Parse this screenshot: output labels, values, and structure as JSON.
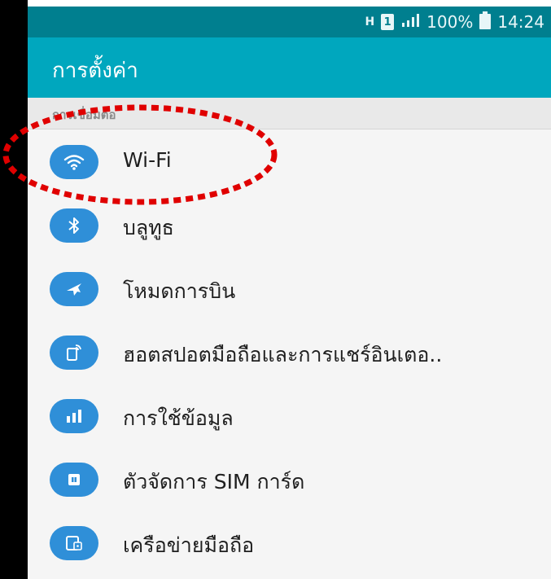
{
  "status_bar": {
    "network_type": "H",
    "sim": "1",
    "signal": "signal-icon",
    "battery_text": "100%",
    "time": "14:24"
  },
  "app_bar": {
    "title": "การตั้งค่า"
  },
  "section": {
    "label": "การเชื่อมต่อ"
  },
  "settings_items": [
    {
      "label": "Wi-Fi",
      "icon": "wifi-icon"
    },
    {
      "label": "บลูทูธ",
      "icon": "bluetooth-icon"
    },
    {
      "label": "โหมดการบิน",
      "icon": "airplane-icon"
    },
    {
      "label": "ฮอตสปอตมือถือและการแชร์อินเตอ..",
      "icon": "hotspot-icon"
    },
    {
      "label": "การใช้ข้อมูล",
      "icon": "data-usage-icon"
    },
    {
      "label": "ตัวจัดการ SIM การ์ด",
      "icon": "sim-card-icon"
    },
    {
      "label": "เครือข่ายมือถือ",
      "icon": "mobile-network-icon"
    }
  ],
  "colors": {
    "status_bar": "#007f8f",
    "app_bar": "#00a7be",
    "icon_circle": "#2f8fd8",
    "highlight": "#e00000"
  }
}
